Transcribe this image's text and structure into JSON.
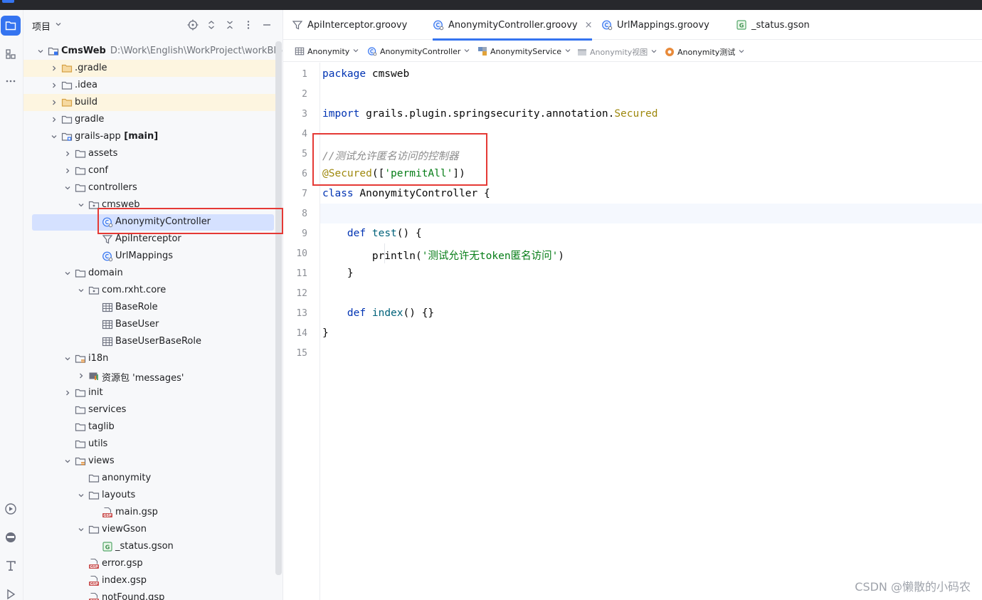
{
  "project": {
    "title": "项目",
    "tree": [
      {
        "level": 0,
        "label": "CmsWeb",
        "bold": true,
        "path": "D:\\Work\\English\\WorkProject\\workBlogs",
        "icon": "module-icon",
        "expand": "down"
      },
      {
        "level": 1,
        "label": ".gradle",
        "icon": "folder-excluded-icon",
        "expand": "right",
        "yellow": true
      },
      {
        "level": 1,
        "label": ".idea",
        "icon": "folder-icon",
        "expand": "right"
      },
      {
        "level": 1,
        "label": "build",
        "icon": "folder-excluded-icon",
        "expand": "right",
        "yellow": true
      },
      {
        "level": 1,
        "label": "gradle",
        "icon": "folder-icon",
        "expand": "right"
      },
      {
        "level": 1,
        "label": "grails-app",
        "suffix": "[main]",
        "icon": "module-folder-icon",
        "expand": "down"
      },
      {
        "level": 2,
        "label": "assets",
        "icon": "folder-icon",
        "expand": "right"
      },
      {
        "level": 2,
        "label": "conf",
        "icon": "folder-icon",
        "expand": "right"
      },
      {
        "level": 2,
        "label": "controllers",
        "icon": "folder-icon",
        "expand": "down"
      },
      {
        "level": 3,
        "label": "cmsweb",
        "icon": "package-icon",
        "expand": "down"
      },
      {
        "level": 4,
        "label": "AnonymityController",
        "icon": "groovy-class-icon",
        "selected": true
      },
      {
        "level": 4,
        "label": "ApiInterceptor",
        "icon": "funnel-icon"
      },
      {
        "level": 4,
        "label": "UrlMappings",
        "icon": "groovy-class-icon"
      },
      {
        "level": 2,
        "label": "domain",
        "icon": "folder-icon",
        "expand": "down"
      },
      {
        "level": 3,
        "label": "com.rxht.core",
        "icon": "package-icon",
        "expand": "down"
      },
      {
        "level": 4,
        "label": "BaseRole",
        "icon": "table-icon"
      },
      {
        "level": 4,
        "label": "BaseUser",
        "icon": "table-icon"
      },
      {
        "level": 4,
        "label": "BaseUserBaseRole",
        "icon": "table-icon"
      },
      {
        "level": 2,
        "label": "i18n",
        "icon": "resource-folder-icon",
        "expand": "down"
      },
      {
        "level": 3,
        "label": "资源包 'messages'",
        "icon": "resource-bundle-icon",
        "expand": "right"
      },
      {
        "level": 2,
        "label": "init",
        "icon": "folder-icon",
        "expand": "right"
      },
      {
        "level": 2,
        "label": "services",
        "icon": "folder-icon"
      },
      {
        "level": 2,
        "label": "taglib",
        "icon": "folder-icon"
      },
      {
        "level": 2,
        "label": "utils",
        "icon": "folder-icon"
      },
      {
        "level": 2,
        "label": "views",
        "icon": "resource-folder-icon",
        "expand": "down"
      },
      {
        "level": 3,
        "label": "anonymity",
        "icon": "folder-icon"
      },
      {
        "level": 3,
        "label": "layouts",
        "icon": "folder-icon",
        "expand": "down"
      },
      {
        "level": 4,
        "label": "main.gsp",
        "icon": "gsp-file-icon"
      },
      {
        "level": 3,
        "label": "viewGson",
        "icon": "folder-icon",
        "expand": "down"
      },
      {
        "level": 4,
        "label": "_status.gson",
        "icon": "gson-file-icon"
      },
      {
        "level": 3,
        "label": "error.gsp",
        "icon": "gsp-file-icon"
      },
      {
        "level": 3,
        "label": "index.gsp",
        "icon": "gsp-file-icon"
      },
      {
        "level": 3,
        "label": "notFound.gsp",
        "icon": "gsp-file-icon"
      }
    ]
  },
  "tabs": [
    {
      "label": "ApiInterceptor.groovy",
      "icon": "funnel-icon",
      "active": false
    },
    {
      "label": "AnonymityController.groovy",
      "icon": "groovy-class-icon",
      "active": true,
      "close": "×"
    },
    {
      "label": "UrlMappings.groovy",
      "icon": "groovy-class-icon",
      "active": false
    },
    {
      "label": "_status.gson",
      "icon": "gson-file-icon",
      "active": false
    }
  ],
  "crumbs": [
    {
      "label": "Anonymity",
      "icon": "table-icon"
    },
    {
      "label": "AnonymityController",
      "icon": "groovy-class-icon"
    },
    {
      "label": "AnonymityService",
      "icon": "service-icon"
    },
    {
      "label": "Anonymity视图",
      "icon": "view-icon",
      "dim": true
    },
    {
      "label": "Anonymity测试",
      "icon": "test-icon"
    }
  ],
  "code": [
    {
      "n": "1",
      "tokens": [
        [
          "kw",
          "package"
        ],
        [
          "",
          "cmsweb"
        ]
      ]
    },
    {
      "n": "2",
      "tokens": []
    },
    {
      "n": "3",
      "tokens": [
        [
          "kw",
          "import"
        ],
        [
          "",
          "grails.plugin.springsecurity.annotation."
        ],
        [
          "ann",
          "Secured"
        ]
      ]
    },
    {
      "n": "4",
      "tokens": []
    },
    {
      "n": "5",
      "tokens": [
        [
          "cmt",
          "//测试允许匿名访问的控制器"
        ]
      ]
    },
    {
      "n": "6",
      "tokens": [
        [
          "ann",
          "@Secured"
        ],
        [
          "",
          "(["
        ],
        [
          "str",
          "'permitAll'"
        ],
        [
          "",
          "])"
        ]
      ]
    },
    {
      "n": "7",
      "tokens": [
        [
          "kw",
          "class"
        ],
        [
          "",
          "AnonymityController {"
        ]
      ]
    },
    {
      "n": "8",
      "tokens": [],
      "current": true
    },
    {
      "n": "9",
      "tokens": [
        [
          "",
          "    "
        ],
        [
          "kw",
          "def"
        ],
        [
          "fn",
          "test"
        ],
        [
          "",
          "() {"
        ]
      ]
    },
    {
      "n": "10",
      "tokens": [
        [
          "",
          "        println("
        ],
        [
          "str",
          "'测试允许无token匿名访问'"
        ],
        [
          "",
          ")"
        ]
      ],
      "guide": true
    },
    {
      "n": "11",
      "tokens": [
        [
          "",
          "    }"
        ]
      ]
    },
    {
      "n": "12",
      "tokens": []
    },
    {
      "n": "13",
      "tokens": [
        [
          "",
          "    "
        ],
        [
          "kw",
          "def"
        ],
        [
          "fn",
          "index"
        ],
        [
          "",
          "() {}"
        ]
      ]
    },
    {
      "n": "14",
      "tokens": [
        [
          "",
          "}"
        ]
      ]
    },
    {
      "n": "15",
      "tokens": []
    }
  ],
  "watermark": "CSDN @懒散的小码农",
  "colors": {
    "accent": "#3574f0",
    "highlight": "#e53935",
    "selection": "#d5e1ff"
  }
}
